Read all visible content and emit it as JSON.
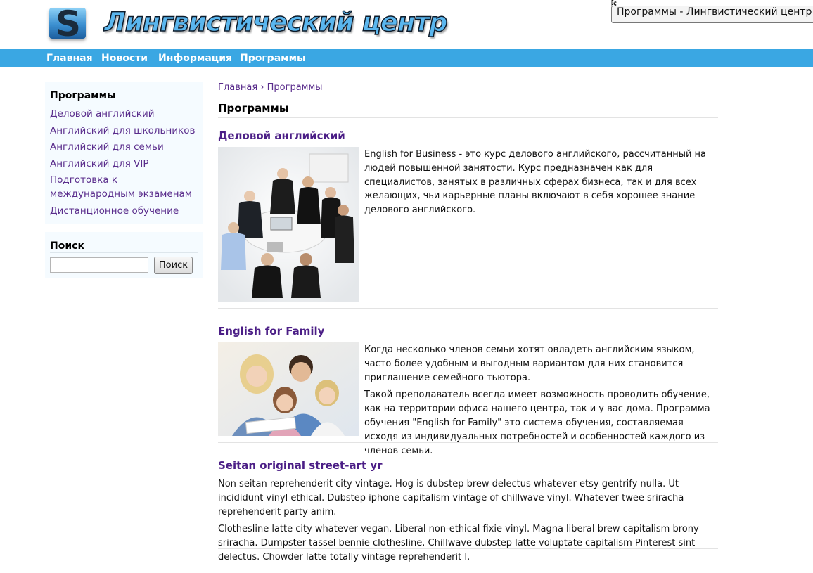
{
  "header": {
    "logo_letter": "S",
    "site_title": "Лингвистический центр",
    "tooltip": "Программы - Лингвистический центр"
  },
  "nav": {
    "items": [
      {
        "label": "Главная"
      },
      {
        "label": "Новости"
      },
      {
        "label": "Информация"
      },
      {
        "label": "Программы"
      }
    ]
  },
  "sidebar": {
    "programs_heading": "Программы",
    "links": [
      {
        "label": "Деловой английский"
      },
      {
        "label": "Английский для школьников"
      },
      {
        "label": "Английский для семьи"
      },
      {
        "label": "Английский для VIP"
      },
      {
        "label": "Подготовка к международным экзаменам"
      },
      {
        "label": "Дистанционное обучение"
      }
    ],
    "search_heading": "Поиск",
    "search_value": "",
    "search_button": "Поиск"
  },
  "main": {
    "breadcrumb_home": "Главная",
    "breadcrumb_sep": "›",
    "breadcrumb_current": "Программы",
    "page_title": "Программы",
    "articles": [
      {
        "title": "Деловой английский",
        "paragraphs": [
          "English for Business - это курс делового английского, рассчитанный на людей повышенной занятости. Курс предназначен как для специалистов, занятых в различных сферах бизнеса, так и для всех желающих, чьи карьерные планы включают в себя хорошее знание делового английского."
        ]
      },
      {
        "title": "English for Family",
        "paragraphs": [
          "Когда несколько членов семьи хотят овладеть английским языком, часто более удобным и выгодным вариантом для них становится приглашение семейного тьютора.",
          "Такой преподаватель всегда имеет возможность проводить обучение, как на территории офиса нашего центра, так и у вас дома. Программа обучения \"English for Family\" это система обучения, составляемая исходя из индивидуальных потребностей и особенностей каждого из членов семьи."
        ]
      },
      {
        "title": "Seitan original street-art yr",
        "paragraphs": [
          "Non seitan reprehenderit city vintage. Hog is dubstep brew delectus whatever etsy gentrify nulla. Ut incididunt vinyl ethical. Dubstep iphone capitalism vintage of chillwave vinyl. Whatever twee sriracha reprehenderit party anim.",
          "Clothesline latte city whatever vegan. Liberal non-ethical fixie vinyl. Magna liberal brew capitalism brony sriracha. Dumpster tassel bennie clothesline. Chillwave dubstep latte voluptate capitalism Pinterest sint delectus. Chowder latte totally vintage reprehenderit I."
        ]
      }
    ]
  },
  "colors": {
    "nav_bg": "#3aa7e3",
    "link": "#5a2d8c",
    "article_title": "#4b1e86",
    "sidebar_bg": "#f5fbff"
  }
}
